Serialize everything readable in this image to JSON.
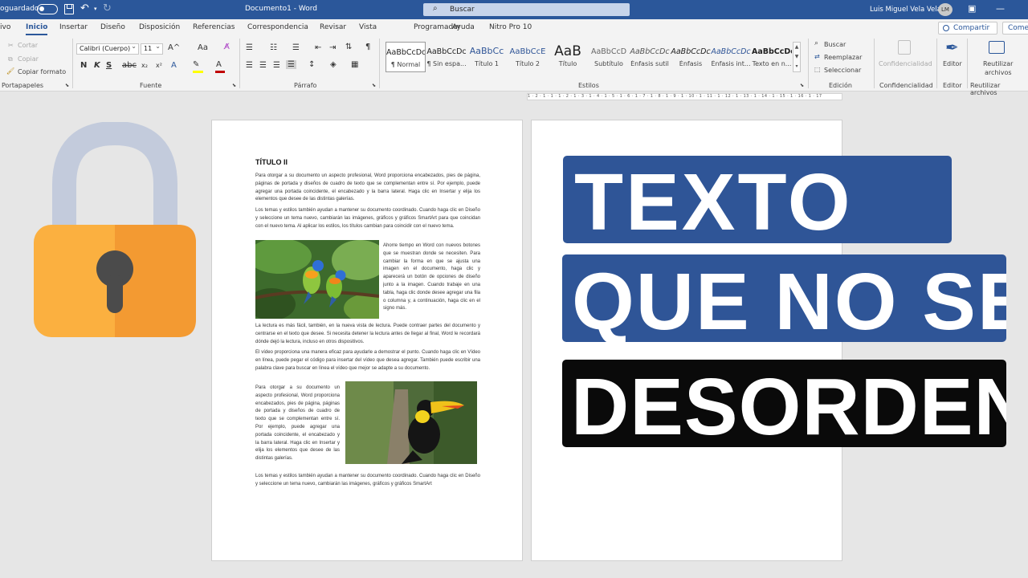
{
  "titlebar": {
    "autosave_label": "oguardado",
    "document_title": "Documento1 - Word",
    "search_label": "Buscar",
    "user_name": "Luis Miguel Vela Vela",
    "user_initials": "LM",
    "color": "#2b579a"
  },
  "ribbon": {
    "tabs": [
      "ivo",
      "Inicio",
      "Insertar",
      "Diseño",
      "Disposición",
      "Referencias",
      "Correspondencia",
      "Revisar",
      "Vista",
      "Ayuda",
      "Programador",
      "Nitro Pro 10"
    ],
    "active_tab": "Inicio",
    "share_label": "Compartir",
    "comments_label": "Come",
    "clipboard": {
      "cut": "Cortar",
      "copy": "Copiar",
      "format_painter": "Copiar formato",
      "label": "Portapapeles"
    },
    "font": {
      "name": "Calibri (Cuerpo)",
      "size": "11",
      "label": "Fuente",
      "bold": "N",
      "italic": "K",
      "underline": "S",
      "grow": "A^",
      "case": "Aa",
      "font_color": "#c00000",
      "highlight_color": "#ffff00"
    },
    "paragraph": {
      "label": "Párrafo"
    },
    "styles": {
      "label": "Estilos",
      "items": [
        {
          "sample": "AaBbCcDc",
          "name": "¶ Normal"
        },
        {
          "sample": "AaBbCcDc",
          "name": "¶ Sin espa..."
        },
        {
          "sample": "AaBbCc",
          "name": "Título 1"
        },
        {
          "sample": "AaBbCcE",
          "name": "Título 2"
        },
        {
          "sample": "AaB",
          "name": "Título"
        },
        {
          "sample": "AaBbCcD",
          "name": "Subtítulo"
        },
        {
          "sample": "AaBbCcDc",
          "name": "Énfasis sutil"
        },
        {
          "sample": "AaBbCcDc",
          "name": "Énfasis"
        },
        {
          "sample": "AaBbCcDc",
          "name": "Énfasis int..."
        },
        {
          "sample": "AaBbCcDc",
          "name": "Texto en n..."
        }
      ]
    },
    "editing": {
      "label": "Edición",
      "find": "Buscar",
      "replace": "Reemplazar",
      "select": "Seleccionar"
    },
    "confidentiality": {
      "button": "Confidencialidad",
      "label": "Confidencialidad"
    },
    "editor": {
      "button": "Editor",
      "label": "Editor"
    },
    "reuse": {
      "button_line1": "Reutilizar",
      "button_line2": "archivos",
      "label": "Reutilizar archivos"
    }
  },
  "ruler": {
    "text": "1 · 2 · 1 · 1 · 1 · 2 · 1 · 3 · 1 · 4 · 1 · 5 · 1 · 6 · 1 · 7 · 1 · 8 · 1 · 9 · 1 · 10 · 1 · 11 · 1 · 12 · 1 · 13 · 1 · 14 · 1 · 15 · 1 · 16 · 1 · 17"
  },
  "document": {
    "heading": "TÍTULO II",
    "p1": "Para otorgar a su documento un aspecto profesional, Word proporciona encabezados, pies de página, páginas de portada y diseños de cuadro de texto que se complementan entre sí. Por ejemplo, puede agregar una portada coincidente, el encabezado y la barra lateral. Haga clic en Insertar y elija los elementos que desee de las distintas galerías.",
    "p2": "Los temas y estilos también ayudan a mantener su documento coordinado. Cuando haga clic en Diseño y seleccione un tema nuevo, cambiarán las imágenes, gráficos y gráficos SmartArt para que coincidan con el nuevo tema. Al aplicar los estilos, los títulos cambian para coincidir con el nuevo tema.",
    "p3": "Ahorre tiempo en Word con nuevos botones que se muestran donde se necesiten. Para cambiar la forma en que se ajusta una imagen en el documento, haga clic y aparecerá un botón de opciones de diseño junto a la imagen. Cuando trabaje en una tabla, haga clic donde desee agregar una fila o columna y, a continuación, haga clic en el signo más.",
    "p4": "La lectura es más fácil, también, en la nueva vista de lectura. Puede contraer partes del documento y centrarse en el texto que desee. Si necesita detener la lectura antes de llegar al final, Word le recordará dónde dejó la lectura, incluso en otros dispositivos.",
    "p5": "El vídeo proporciona una manera eficaz para ayudarle a demostrar el punto. Cuando haga clic en Vídeo en línea, puede pegar el código para insertar del vídeo que desea agregar. También puede escribir una palabra clave para buscar en línea el vídeo que mejor se adapte a su documento.",
    "p6": "Para otorgar a su documento un aspecto profesional, Word proporciona encabezados, pies de página, páginas de portada y diseños de cuadro de texto que se complementan entre sí. Por ejemplo, puede agregar una portada coincidente, el encabezado y la barra lateral. Haga clic en Insertar y elija los elementos que desee de las distintas galerías.",
    "p7": "Los temas y estilos también ayudan a mantener su documento coordinado. Cuando haga clic en Diseño y seleccione un tema nuevo, cambiarán las imágenes, gráficos y gráficos SmartArt"
  },
  "overlay": {
    "line1": "TEXTO",
    "line2": "QUE NO SE",
    "line3": "DESORDENE",
    "blue": "#2f5597",
    "black": "#0a0a0a",
    "lock_body": "#f7a33a",
    "lock_shackle": "#c3cbdc"
  }
}
